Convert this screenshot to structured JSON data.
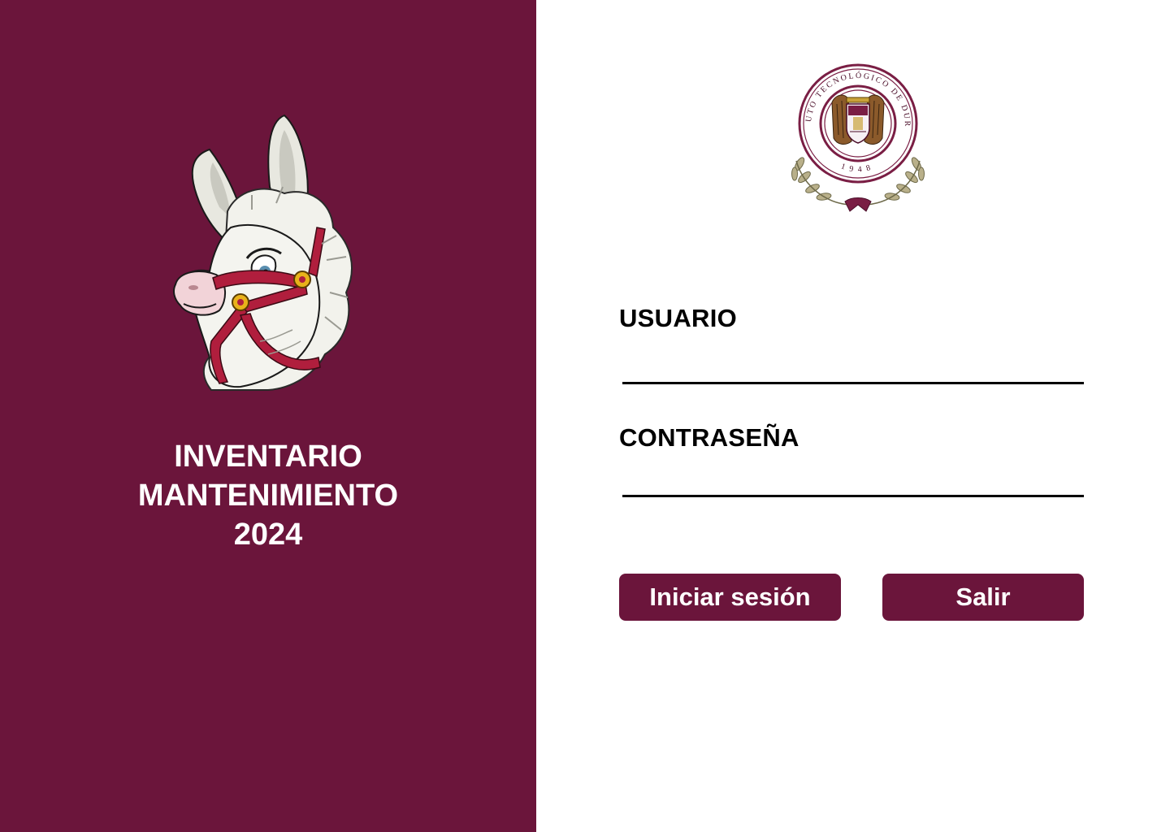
{
  "left_panel": {
    "background_color": "#6b153b",
    "mascot": "donkey-mascot-with-halter",
    "title_lines": [
      "INVENTARIO",
      "MANTENIMIENTO",
      "2024"
    ]
  },
  "right_panel": {
    "seal": {
      "name": "institution-seal",
      "text_top": "INSTITUTO TECNOLÓGICO DE DURANGO",
      "text_bottom": "1948"
    },
    "form": {
      "user_label": "USUARIO",
      "user_value": "",
      "password_label": "CONTRASEÑA",
      "password_value": ""
    },
    "buttons": {
      "login_label": "Iniciar sesión",
      "exit_label": "Salir",
      "color": "#6b153b"
    }
  }
}
